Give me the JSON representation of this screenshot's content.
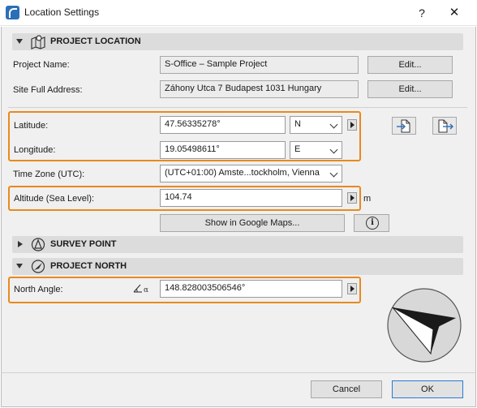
{
  "window": {
    "title": "Location Settings",
    "help_glyph": "?",
    "close_glyph": "✕"
  },
  "project_location": {
    "section_title": "PROJECT LOCATION",
    "project_name_label": "Project Name:",
    "project_name_value": "S-Office – Sample Project",
    "site_address_label": "Site Full Address:",
    "site_address_value": "Záhony Utca 7 Budapest 1031 Hungary",
    "edit_label": "Edit...",
    "latitude_label": "Latitude:",
    "latitude_value": "47.56335278°",
    "latitude_hemisphere": "N",
    "longitude_label": "Longitude:",
    "longitude_value": "19.05498611°",
    "longitude_hemisphere": "E",
    "timezone_label": "Time Zone (UTC):",
    "timezone_value": "(UTC+01:00) Amste...tockholm, Vienna",
    "altitude_label": "Altitude (Sea Level):",
    "altitude_value": "104.74",
    "altitude_unit": "m",
    "google_maps_label": "Show in Google Maps...",
    "info_glyph": "i"
  },
  "survey_point": {
    "section_title": "SURVEY POINT"
  },
  "project_north": {
    "section_title": "PROJECT NORTH",
    "north_angle_label": "North Angle:",
    "north_angle_value": "148.828003506546°"
  },
  "footer": {
    "cancel_label": "Cancel",
    "ok_label": "OK"
  },
  "colors": {
    "highlight": "#e88a1d",
    "ok_border": "#2a7ad6",
    "app_icon": "#2b6fb8"
  }
}
